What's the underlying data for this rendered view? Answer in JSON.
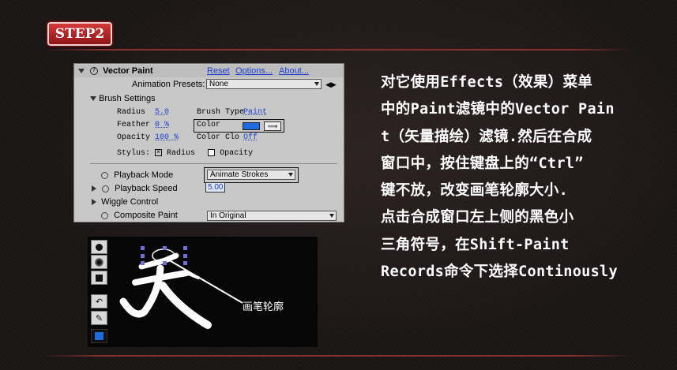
{
  "step_label": "STEP2",
  "panel": {
    "effect_name": "Vector Paint",
    "reset": "Reset",
    "options": "Options...",
    "about": "About...",
    "presets_label": "Animation Presets:",
    "presets_value": "None",
    "brush_settings": "Brush Settings",
    "radius_label": "Radius",
    "radius_value": "5.0",
    "feather_label": "Feather",
    "feather_value": "0 %",
    "opacity_label": "Opacity",
    "opacity_value": "100 %",
    "brush_type_label": "Brush Type",
    "brush_type_value": "Paint",
    "color_label": "Color",
    "color_clone_label": "Color Clo",
    "color_clone_value": "Off",
    "brush_color": "#1e6be0",
    "stylus_label": "Stylus:",
    "stylus_radius": "Radius",
    "stylus_opacity": "Opacity",
    "playback_mode_label": "Playback Mode",
    "playback_mode_value": "Animate Strokes",
    "playback_speed_label": "Playback Speed",
    "playback_speed_value": "5.00",
    "wiggle_control": "Wiggle Control",
    "composite_label": "Composite Paint",
    "composite_value": "In Original"
  },
  "canvas": {
    "caption": "画笔轮廓"
  },
  "description": [
    "对它使用Effects（效果）菜单",
    "中的Paint滤镜中的Vector Pain",
    "t（矢量描绘）滤镜.然后在合成",
    "窗口中，按住键盘上的“Ctrl”",
    "键不放，改变画笔轮廓大小.",
    "点击合成窗口左上侧的黑色小",
    "三角符号，在Shift-Paint",
    "Records命令下选择Continously"
  ]
}
